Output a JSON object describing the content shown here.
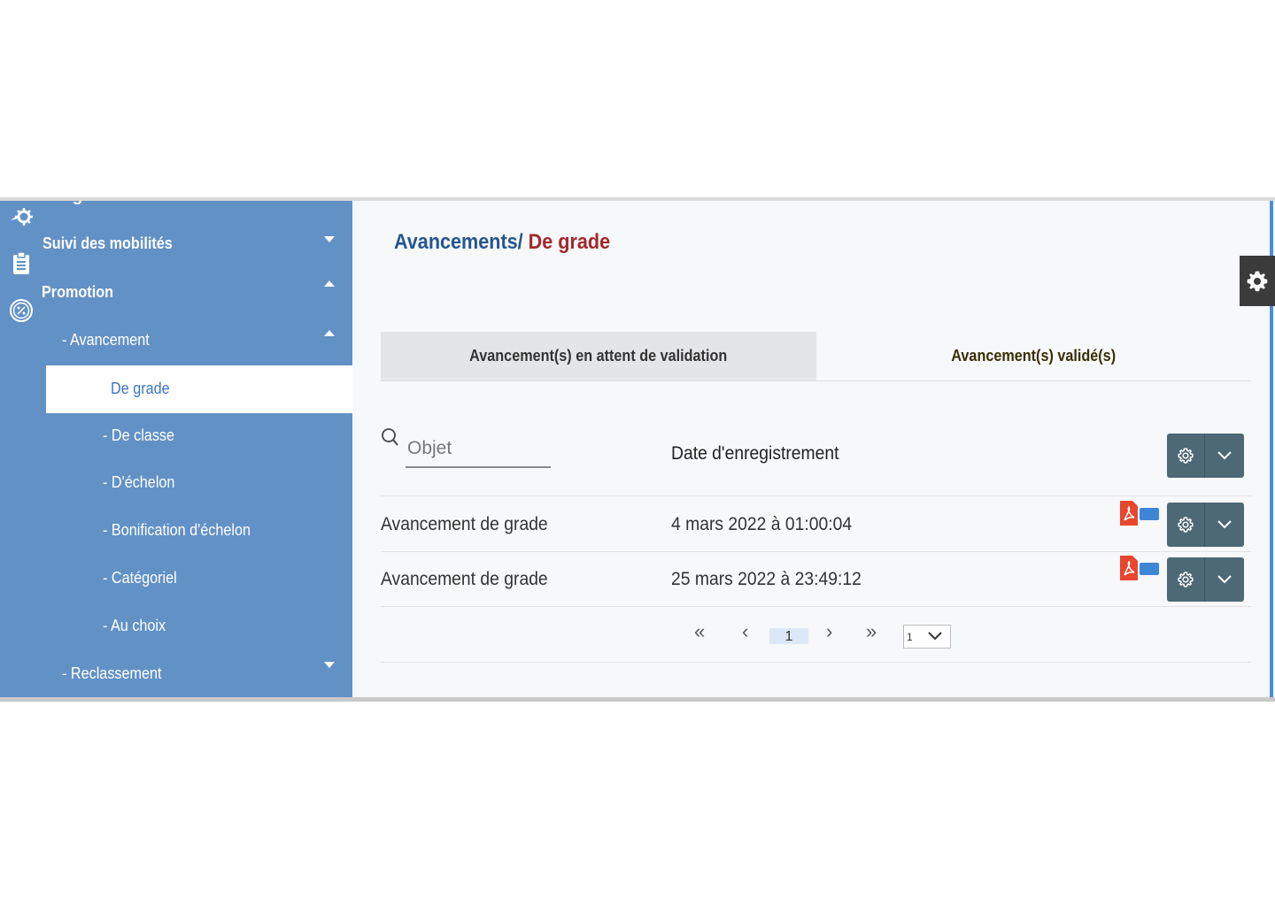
{
  "sidebar": {
    "cut_label": "Intégration",
    "items": [
      {
        "label": "Suivi des mobilités"
      },
      {
        "label": "Promotion"
      },
      {
        "label": "- Avancement"
      },
      {
        "label": "De grade"
      },
      {
        "label": "- De classe"
      },
      {
        "label": "- D'échelon"
      },
      {
        "label": "- Bonification d'échelon"
      },
      {
        "label": "- Catégoriel"
      },
      {
        "label": "- Au choix"
      },
      {
        "label": "- Reclassement"
      }
    ]
  },
  "page": {
    "breadcrumb_root": "Avancements/",
    "breadcrumb_current": " De grade"
  },
  "tabs": [
    {
      "label": "Avancement(s) en attent de validation"
    },
    {
      "label": "Avancement(s) validé(s)"
    }
  ],
  "table": {
    "search_placeholder": "Objet",
    "col_date": "Date d'enregistrement",
    "rows": [
      {
        "objet": "Avancement de grade",
        "date": "4 mars 2022 à 01:00:04"
      },
      {
        "objet": "Avancement de grade",
        "date": "25 mars 2022 à 23:49:12"
      }
    ]
  },
  "pagination": {
    "first": "«",
    "prev": "‹",
    "current_page": "1",
    "next": "›",
    "last": "»",
    "per_page": "1"
  },
  "colors": {
    "sidebar_bg": "#6291c6",
    "title_root": "#23568f",
    "title_current": "#a3282a",
    "action_btn": "#4d6976"
  }
}
